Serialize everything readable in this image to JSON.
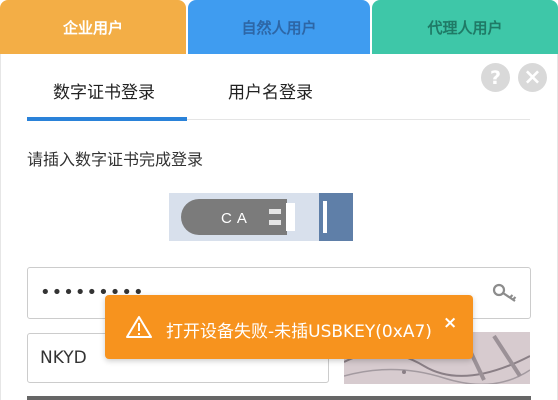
{
  "role_tabs": [
    {
      "label": "企业用户",
      "active": true
    },
    {
      "label": "自然人用户",
      "active": false
    },
    {
      "label": "代理人用户",
      "active": false
    }
  ],
  "login_tabs": [
    {
      "label": "数字证书登录",
      "active": true
    },
    {
      "label": "用户名登录",
      "active": false
    }
  ],
  "hint": "请插入数字证书完成登录",
  "usbkey": {
    "label": "CA"
  },
  "password": {
    "value": "•••••••••"
  },
  "verify_code": {
    "value": "NKYD"
  },
  "toast": {
    "message": "打开设备失败-未插USBKEY(0xA7)",
    "close": "×"
  },
  "icons": {
    "help": "?",
    "close": "×"
  },
  "colors": {
    "enterprise": "#f3ae46",
    "individual": "#3f9cf0",
    "agent": "#3ec7a8",
    "accent": "#2a82d9",
    "toast": "#f7931e"
  }
}
